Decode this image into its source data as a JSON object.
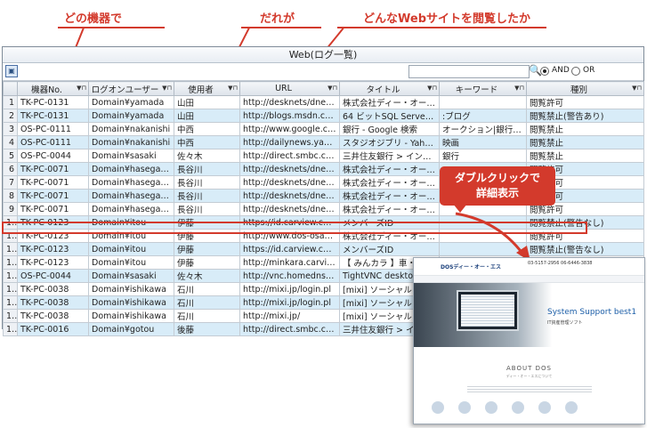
{
  "callouts": {
    "which_device": "どの機器で",
    "who": "だれが",
    "what_site": "どんなWebサイトを閲覧したか",
    "double_click": "ダブルクリックで",
    "detail_view": "詳細表示"
  },
  "window": {
    "title": "Web(ログ一覧)",
    "search_placeholder": "",
    "search_icon": "magnifier-icon",
    "and_label": "AND",
    "or_label": "OR",
    "and_selected": true
  },
  "columns": [
    "機器No.",
    "ログオンユーザー",
    "使用者",
    "URL",
    "タイトル",
    "キーワード",
    "種別"
  ],
  "rows": [
    {
      "no": "1",
      "device": "TK-PC-0131",
      "user": "Domain¥yamada",
      "person": "山田",
      "url": "http://desknets/dnet.ex…",
      "title": "株式会社ディー・オー・エス…",
      "keyword": "",
      "type": "閲覧許可"
    },
    {
      "no": "2",
      "device": "TK-PC-0131",
      "user": "Domain¥yamada",
      "person": "山田",
      "url": "http://blogs.msdn.com/…",
      "title": "64 ビットSQL Server か…",
      "keyword": ":ブログ",
      "type": "閲覧禁止(警告あり)"
    },
    {
      "no": "3",
      "device": "OS-PC-0111",
      "user": "Domain¥nakanishi",
      "person": "中西",
      "url": "http://www.google.com…",
      "title": "銀行 - Google 検索",
      "keyword": "オークション|銀行|証券",
      "type": "閲覧禁止"
    },
    {
      "no": "4",
      "device": "OS-PC-0111",
      "user": "Domain¥nakanishi",
      "person": "中西",
      "url": "http://dailynews.yahoo…",
      "title": "スタジオジブリ - Yahoo!ニ…",
      "keyword": "映画",
      "type": "閲覧禁止"
    },
    {
      "no": "5",
      "device": "OS-PC-0044",
      "user": "Domain¥sasaki",
      "person": "佐々木",
      "url": "http://direct.smbc.co.jp…",
      "title": "三井住友銀行 > インタ…",
      "keyword": "銀行",
      "type": "閲覧禁止"
    },
    {
      "no": "6",
      "device": "TK-PC-0071",
      "user": "Domain¥hasegawa",
      "person": "長谷川",
      "url": "http://desknets/dnet.ex…",
      "title": "株式会社ディー・オー・エス…",
      "keyword": "",
      "type": "閲覧許可"
    },
    {
      "no": "7",
      "device": "TK-PC-0071",
      "user": "Domain¥hasegawa",
      "person": "長谷川",
      "url": "http://desknets/dnet.ex…",
      "title": "株式会社ディー・オー・エス…",
      "keyword": "",
      "type": "閲覧許可"
    },
    {
      "no": "8",
      "device": "TK-PC-0071",
      "user": "Domain¥hasegawa",
      "person": "長谷川",
      "url": "http://desknets/dnet.ex…",
      "title": "株式会社ディー・オー・エス…",
      "keyword": "",
      "type": "閲覧許可"
    },
    {
      "no": "9",
      "device": "TK-PC-0071",
      "user": "Domain¥hasegawa",
      "person": "長谷川",
      "url": "http://desknets/dnet.ex…",
      "title": "株式会社ディー・オー・エス…",
      "keyword": "",
      "type": "閲覧許可"
    },
    {
      "no": "10",
      "device": "TK-PC-0123",
      "user": "Domain¥itou",
      "person": "伊藤",
      "url": "https://id.carview.co.jp/…",
      "title": "メンバーズID",
      "keyword": "",
      "type": "閲覧禁止(警告なし)"
    },
    {
      "no": "11",
      "device": "TK-PC-0123",
      "user": "Domain¥itou",
      "person": "伊藤",
      "url": "http://www.dos-osak…",
      "title": "株式会社ディー・オー・エス…",
      "keyword": "",
      "type": "閲覧許可"
    },
    {
      "no": "12",
      "device": "TK-PC-0123",
      "user": "Domain¥itou",
      "person": "伊藤",
      "url": "https://id.carview.co.jp/…",
      "title": "メンバーズID",
      "keyword": "",
      "type": "閲覧禁止(警告なし)"
    },
    {
      "no": "13",
      "device": "TK-PC-0123",
      "user": "Domain¥itou",
      "person": "伊藤",
      "url": "http://minkara.carview…",
      "title": "【 みんカラ 】車・自動車S…",
      "keyword": ":ブログ",
      "type": "閲覧禁止(警告あり)"
    },
    {
      "no": "14",
      "device": "OS-PC-0044",
      "user": "Domain¥sasaki",
      "person": "佐々木",
      "url": "http://vnc.homedns.org…",
      "title": "TightVNC desktop [",
      "keyword": "",
      "type": ""
    },
    {
      "no": "15",
      "device": "TK-PC-0038",
      "user": "Domain¥ishikawa",
      "person": "石川",
      "url": "http://mixi.jp/login.pl",
      "title": "[mixi] ソーシャル・ネット…",
      "keyword": "",
      "type": ""
    },
    {
      "no": "16",
      "device": "TK-PC-0038",
      "user": "Domain¥ishikawa",
      "person": "石川",
      "url": "http://mixi.jp/login.pl",
      "title": "[mixi] ソーシャル・ネット…",
      "keyword": "",
      "type": ""
    },
    {
      "no": "17",
      "device": "TK-PC-0038",
      "user": "Domain¥ishikawa",
      "person": "石川",
      "url": "http://mixi.jp/",
      "title": "[mixi] ソーシャル・ネット…",
      "keyword": "",
      "type": ""
    },
    {
      "no": "18",
      "device": "TK-PC-0016",
      "user": "Domain¥gotou",
      "person": "後藤",
      "url": "http://direct.smbc.co.jp…",
      "title": "三井住友銀行 > イン…",
      "keyword": "",
      "type": ""
    }
  ],
  "highlight_row": 11,
  "preview": {
    "logo": "DOSディー・オー・エス",
    "phone": "03-5157-2956 06-6446-3838",
    "hero_title": "System Support best1",
    "hero_sub": "IT資産管理ソフト",
    "about_title": "ABOUT DOS",
    "about_sub": "ディー・オー・エスについて"
  },
  "colors": {
    "accent_red": "#d33a2c",
    "row_alt_blue": "#d8ecf8",
    "link_blue": "#1d5fa8"
  }
}
